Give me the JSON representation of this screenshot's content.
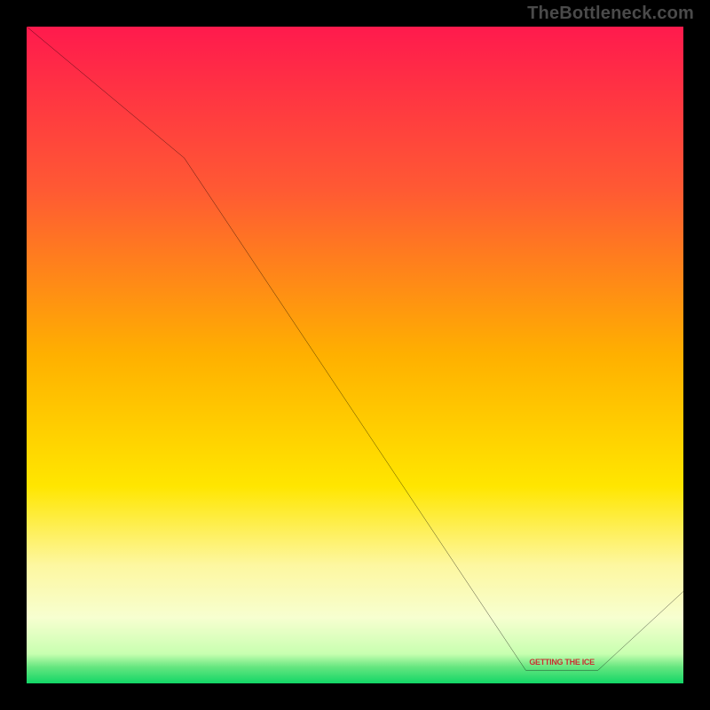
{
  "watermark": "TheBottleneck.com",
  "series_label": "GETTING THE ICE",
  "chart_data": {
    "type": "line",
    "title": "",
    "xlabel": "",
    "ylabel": "",
    "xlim": [
      0,
      100
    ],
    "ylim": [
      0,
      100
    ],
    "grid": false,
    "legend": false,
    "gradient": {
      "stops": [
        {
          "pos": 0.0,
          "color": "#ff1a4d"
        },
        {
          "pos": 0.25,
          "color": "#ff5a33"
        },
        {
          "pos": 0.5,
          "color": "#ffb000"
        },
        {
          "pos": 0.7,
          "color": "#ffe600"
        },
        {
          "pos": 0.82,
          "color": "#fdf7a0"
        },
        {
          "pos": 0.9,
          "color": "#f7ffd0"
        },
        {
          "pos": 0.955,
          "color": "#c8ffb0"
        },
        {
          "pos": 0.975,
          "color": "#66e680"
        },
        {
          "pos": 1.0,
          "color": "#12d666"
        }
      ]
    },
    "series": [
      {
        "name": "bottleneck-curve",
        "x": [
          0,
          24,
          76,
          87,
          100
        ],
        "y": [
          100,
          80,
          2,
          2,
          14
        ]
      }
    ],
    "label_anchor": {
      "x": 81.5,
      "y": 3.2
    }
  }
}
